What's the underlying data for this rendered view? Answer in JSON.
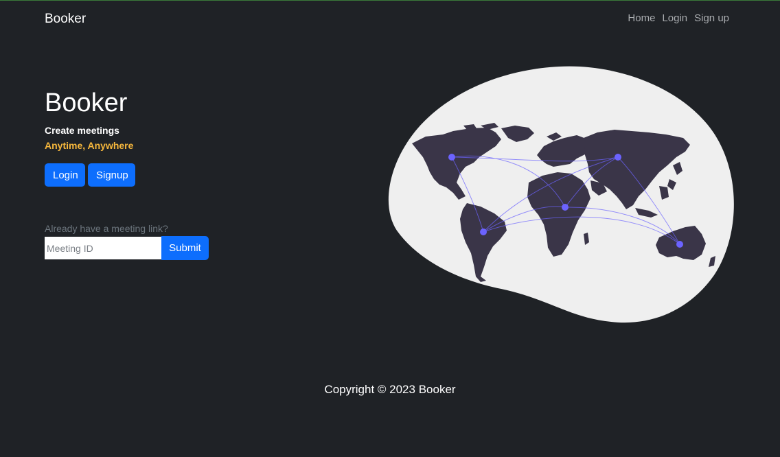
{
  "navbar": {
    "brand": "Booker",
    "links": [
      "Home",
      "Login",
      "Sign up"
    ]
  },
  "hero": {
    "title": "Booker",
    "subtitle": "Create meetings",
    "tagline": "Anytime, Anywhere",
    "login_button": "Login",
    "signup_button": "Signup"
  },
  "meeting": {
    "label": "Already have a meeting link?",
    "input_placeholder": "Meeting ID",
    "input_value": "",
    "submit_button": "Submit"
  },
  "footer": {
    "copyright": "Copyright © 2023 Booker"
  },
  "colors": {
    "background": "#1f2226",
    "primary": "#0d6efd",
    "accent": "#f6b73c",
    "muted": "#6c757d",
    "blob": "#efefef",
    "continents": "#3a3548",
    "network": "#6c63ff"
  }
}
